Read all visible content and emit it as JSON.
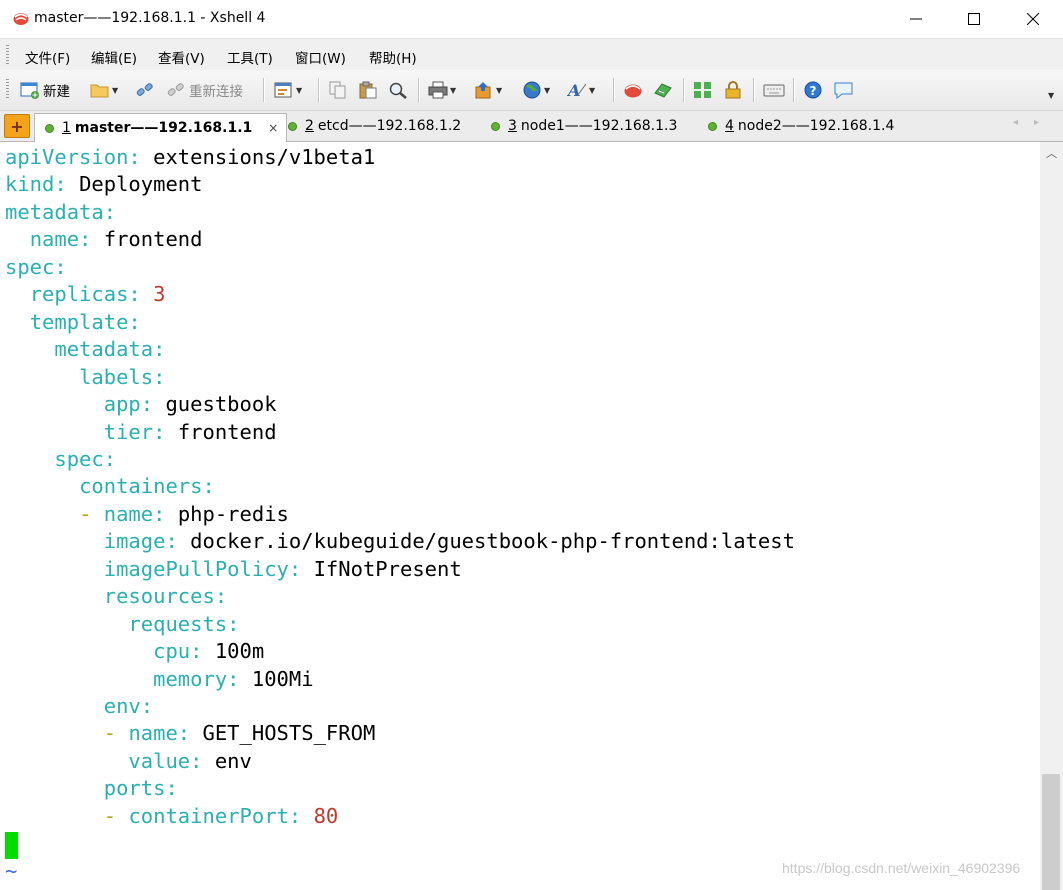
{
  "window": {
    "title": "master——192.168.1.1 - Xshell 4"
  },
  "menu": [
    "文件(F)",
    "编辑(E)",
    "查看(V)",
    "工具(T)",
    "窗口(W)",
    "帮助(H)"
  ],
  "toolbar": {
    "new_label": "新建",
    "reconnect_label": "重新连接"
  },
  "tabs": [
    {
      "num": "1",
      "label": "master——192.168.1.1",
      "active": true
    },
    {
      "num": "2",
      "label": "etcd——192.168.1.2"
    },
    {
      "num": "3",
      "label": "node1——192.168.1.3"
    },
    {
      "num": "4",
      "label": "node2——192.168.1.4"
    }
  ],
  "tab_close": "×",
  "terminal": {
    "lines": [
      {
        "indent": "",
        "key": "apiVersion",
        "value": "extensions/v1beta1"
      },
      {
        "indent": "",
        "key": "kind",
        "value": "Deployment"
      },
      {
        "indent": "",
        "key": "metadata",
        "value": ""
      },
      {
        "indent": "  ",
        "key": "name",
        "value": "frontend"
      },
      {
        "indent": "",
        "key": "spec",
        "value": ""
      },
      {
        "indent": "  ",
        "key": "replicas",
        "value": "3",
        "numeric": true
      },
      {
        "indent": "  ",
        "key": "template",
        "value": ""
      },
      {
        "indent": "    ",
        "key": "metadata",
        "value": ""
      },
      {
        "indent": "      ",
        "key": "labels",
        "value": ""
      },
      {
        "indent": "        ",
        "key": "app",
        "value": "guestbook"
      },
      {
        "indent": "        ",
        "key": "tier",
        "value": "frontend"
      },
      {
        "indent": "    ",
        "key": "spec",
        "value": ""
      },
      {
        "indent": "      ",
        "key": "containers",
        "value": ""
      },
      {
        "indent": "      ",
        "dash": true,
        "key": "name",
        "value": "php-redis"
      },
      {
        "indent": "        ",
        "key": "image",
        "value": "docker.io/kubeguide/guestbook-php-frontend:latest"
      },
      {
        "indent": "        ",
        "key": "imagePullPolicy",
        "value": "IfNotPresent"
      },
      {
        "indent": "        ",
        "key": "resources",
        "value": ""
      },
      {
        "indent": "          ",
        "key": "requests",
        "value": ""
      },
      {
        "indent": "            ",
        "key": "cpu",
        "value": "100m"
      },
      {
        "indent": "            ",
        "key": "memory",
        "value": "100Mi"
      },
      {
        "indent": "        ",
        "key": "env",
        "value": ""
      },
      {
        "indent": "        ",
        "dash": true,
        "key": "name",
        "value": "GET_HOSTS_FROM"
      },
      {
        "indent": "          ",
        "key": "value",
        "value": "env"
      },
      {
        "indent": "        ",
        "key": "ports",
        "value": ""
      },
      {
        "indent": "        ",
        "dash": true,
        "key": "containerPort",
        "value": "80",
        "numeric": true
      }
    ],
    "tilde": "~"
  },
  "watermark": "https://blog.csdn.net/weixin_46902396",
  "colors": {
    "key": "#2ab0b0",
    "number": "#c0392b",
    "cursor": "#00dd00",
    "tilde": "#3a6fd8"
  }
}
